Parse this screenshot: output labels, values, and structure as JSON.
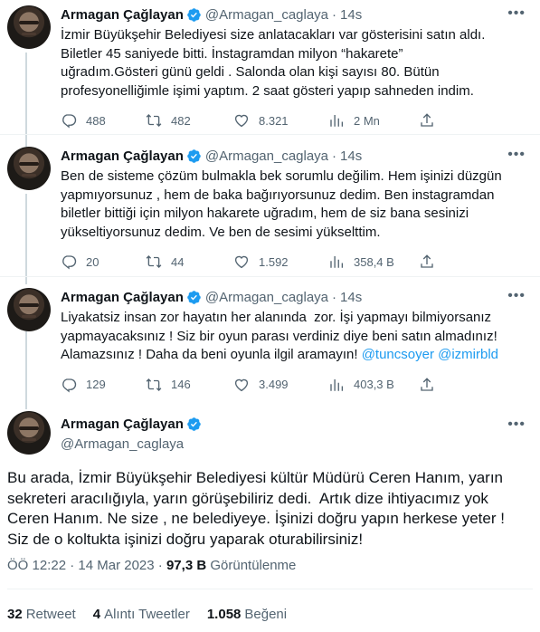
{
  "author": {
    "name": "Armagan Çağlayan",
    "handle": "@Armagan_caglaya",
    "separator": "·"
  },
  "colors": {
    "verified": "#1d9bf0",
    "link": "#1d9bf0",
    "secondary": "#536471"
  },
  "tweets": [
    {
      "time": "14s",
      "text": "İzmir Büyükşehir Belediyesi size anlatacakları var gösterisini satın aldı.\nBiletler 45 saniyede bitti. İnstagramdan milyon “hakarete”\nuğradım.Gösteri günü geldi . Salonda olan kişi sayısı 80. Bütün\nprofesyonelliğimle işimi yaptım. 2 saat gösteri yapıp sahneden indim.",
      "replies": "488",
      "retweets": "482",
      "likes": "8.321",
      "views": "2 Mn"
    },
    {
      "time": "14s",
      "text": "Ben de sisteme çözüm bulmakla bek sorumlu değilim. Hem işinizi düzgün\nyapmıyorsunuz , hem de baka bağırıyorsunuz dedim. Ben instagramdan\nbiletler bittiği için milyon hakarete uğradım, hem de siz bana sesinizi\nyükseltiyorsunuz dedim. Ve ben de sesimi yükselttim.",
      "replies": "20",
      "retweets": "44",
      "likes": "1.592",
      "views": "358,4 B"
    },
    {
      "time": "14s",
      "text": "Liyakatsiz insan zor hayatın her alanında  zor. İşi yapmayı bilmiyorsanız\nyapmayacaksınız ! Siz bir oyun parası verdiniz diye beni satın almadınız!\nAlamazsınız ! Daha da beni oyunla ilgil aramayın! ",
      "mentions": [
        "@tuncsoyer",
        "@izmirbld"
      ],
      "replies": "129",
      "retweets": "146",
      "likes": "3.499",
      "views": "403,3 B"
    }
  ],
  "main": {
    "text": "Bu arada, İzmir Büyükşehir Belediyesi kültür Müdürü Ceren Hanım, yarın\nsekreteri aracılığıyla, yarın görüşebiliriz dedi.  Artık dize ihtiyacımız yok\nCeren Hanım. Ne size , ne belediyeye. İşinizi doğru yapın herkese yeter !\nSiz de o koltukta işinizi doğru yaparak oturabilirsiniz!",
    "time": "ÖÖ 12:22",
    "date": "14 Mar 2023",
    "views_count": "97,3 B",
    "views_label": "Görüntülenme",
    "retweets_count": "32",
    "retweets_label": "Retweet",
    "quotes_count": "4",
    "quotes_label": "Alıntı Tweetler",
    "likes_count": "1.058",
    "likes_label": "Beğeni"
  }
}
